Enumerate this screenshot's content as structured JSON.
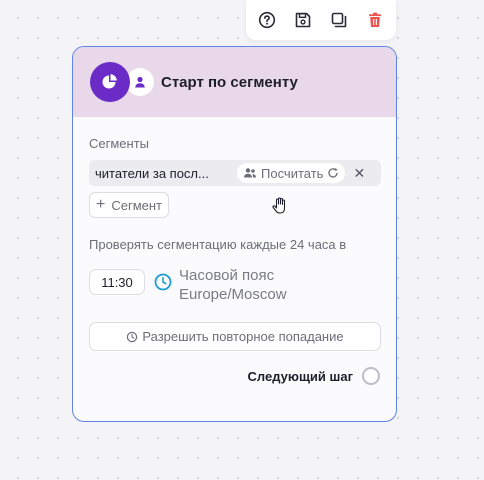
{
  "toolbar": {
    "icons": [
      "help-icon",
      "save-icon",
      "duplicate-icon",
      "delete-icon"
    ]
  },
  "node": {
    "title": "Старт по сегменту",
    "segments_label": "Сегменты",
    "segment_name": "читатели за посл...",
    "count_button_label": "Посчитать",
    "add_segment_label": "Сегмент",
    "check_text": "Проверять сегментацию каждые 24 часа в",
    "time_value": "11:30",
    "timezone_text": "Часовой пояс Europe/Moscow",
    "reentry_label": "Разрешить повторное попадание",
    "next_step_label": "Следующий шаг"
  },
  "colors": {
    "accent": "#6a2bc6",
    "card_border": "#5d84e6",
    "header_bg": "#e8d8e9",
    "delete": "#ef5350",
    "clock": "#1f9bd6"
  }
}
